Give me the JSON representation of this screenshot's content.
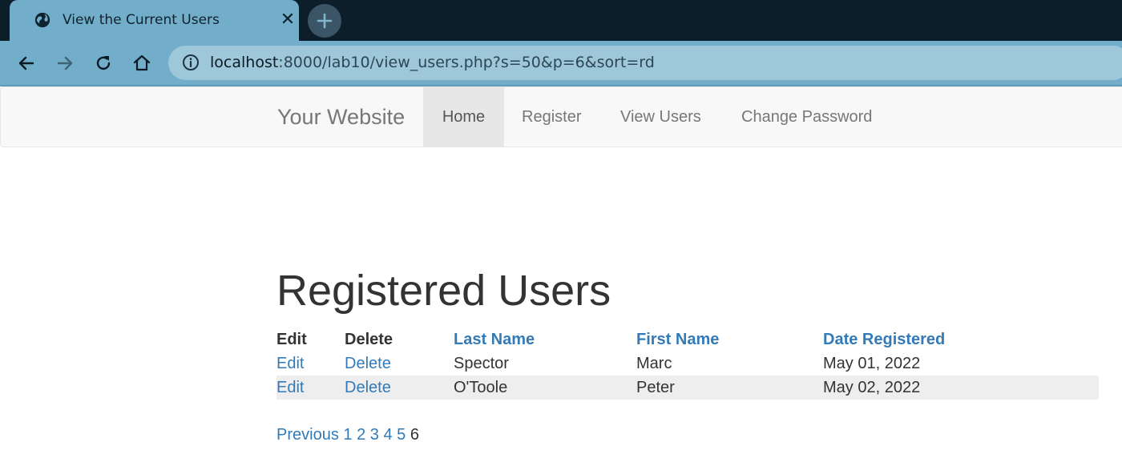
{
  "browser": {
    "tab_title": "View the Current Users",
    "url_host": "localhost",
    "url_rest": ":8000/lab10/view_users.php?s=50&p=6&sort=rd",
    "icons": [
      "globe-icon",
      "close-icon",
      "plus-icon",
      "back-arrow-icon",
      "forward-arrow-icon",
      "reload-icon",
      "home-icon",
      "info-icon"
    ]
  },
  "navbar": {
    "brand": "Your Website",
    "items": [
      {
        "label": "Home",
        "active": true
      },
      {
        "label": "Register",
        "active": false
      },
      {
        "label": "View Users",
        "active": false
      },
      {
        "label": "Change Password",
        "active": false
      }
    ]
  },
  "main": {
    "heading": "Registered Users",
    "table": {
      "headers": [
        "Edit",
        "Delete",
        "Last Name",
        "First Name",
        "Date Registered"
      ],
      "rows": [
        {
          "edit": "Edit",
          "delete": "Delete",
          "last_name": "Spector",
          "first_name": "Marc",
          "date": "May 01, 2022"
        },
        {
          "edit": "Edit",
          "delete": "Delete",
          "last_name": "O'Toole",
          "first_name": "Peter",
          "date": "May 02, 2022"
        }
      ]
    },
    "pagination": {
      "previous": "Previous",
      "pages": [
        "1",
        "2",
        "3",
        "4",
        "5"
      ],
      "current": "6"
    }
  },
  "colors": {
    "link": "#337ab7",
    "navbar_bg": "#f8f8f8",
    "active_nav_bg": "#e7e7e7",
    "browser_frame": "#72adc9",
    "browser_titlebar": "#0c1e2a"
  }
}
